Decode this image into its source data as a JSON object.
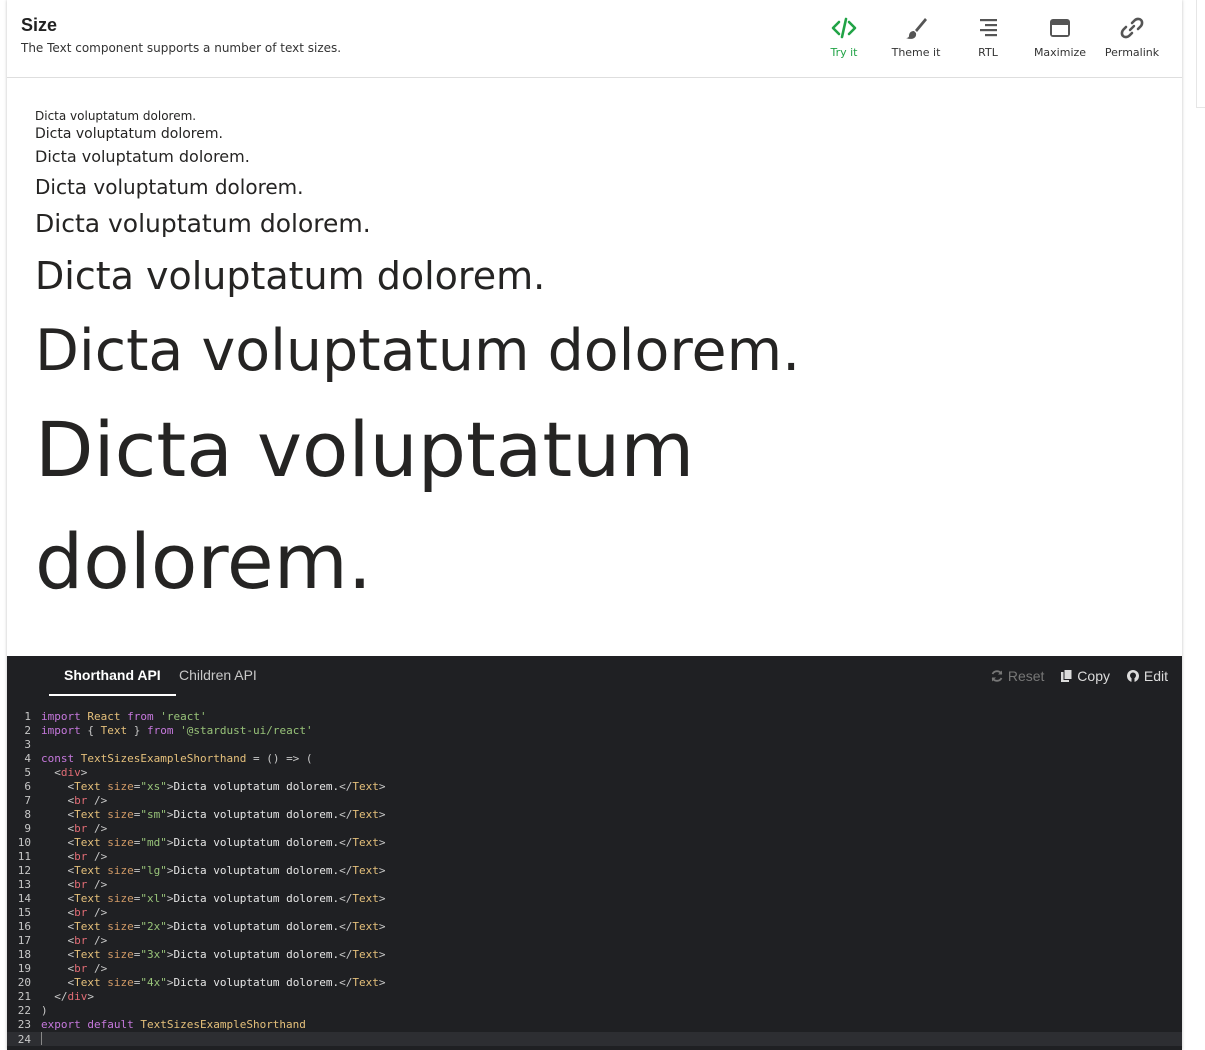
{
  "header": {
    "title": "Size",
    "description": "The Text component supports a number of text sizes."
  },
  "toolbar": [
    {
      "label": "Try it",
      "icon": "code-icon",
      "active": true
    },
    {
      "label": "Theme it",
      "icon": "paintbrush-icon",
      "active": false
    },
    {
      "label": "RTL",
      "icon": "align-right-icon",
      "active": false
    },
    {
      "label": "Maximize",
      "icon": "maximize-icon",
      "active": false
    },
    {
      "label": "Permalink",
      "icon": "link-icon",
      "active": false
    }
  ],
  "preview": {
    "samples": [
      {
        "size": "xs",
        "text": "Dicta voluptatum dolorem."
      },
      {
        "size": "sm",
        "text": "Dicta voluptatum dolorem."
      },
      {
        "size": "md",
        "text": "Dicta voluptatum dolorem."
      },
      {
        "size": "lg",
        "text": "Dicta voluptatum dolorem."
      },
      {
        "size": "xl",
        "text": "Dicta voluptatum dolorem."
      },
      {
        "size": "2x",
        "text": "Dicta voluptatum dolorem."
      },
      {
        "size": "3x",
        "text": "Dicta voluptatum dolorem."
      },
      {
        "size": "4x",
        "text": "Dicta voluptatum dolorem."
      }
    ]
  },
  "code_panel": {
    "tabs": [
      {
        "label": "Shorthand API",
        "active": true
      },
      {
        "label": "Children API",
        "active": false
      }
    ],
    "actions": {
      "reset": "Reset",
      "copy": "Copy",
      "edit": "Edit"
    },
    "lines": [
      [
        [
          "kw",
          "import"
        ],
        [
          "tk",
          " "
        ],
        [
          "id",
          "React"
        ],
        [
          "tk",
          " "
        ],
        [
          "kw",
          "from"
        ],
        [
          "tk",
          " "
        ],
        [
          "str",
          "'react'"
        ]
      ],
      [
        [
          "kw",
          "import"
        ],
        [
          "tk",
          " { "
        ],
        [
          "id",
          "Text"
        ],
        [
          "tk",
          " } "
        ],
        [
          "kw",
          "from"
        ],
        [
          "tk",
          " "
        ],
        [
          "str",
          "'@stardust-ui/react'"
        ]
      ],
      [],
      [
        [
          "kw",
          "const"
        ],
        [
          "tk",
          " "
        ],
        [
          "id",
          "TextSizesExampleShorthand"
        ],
        [
          "tk",
          " = () => ("
        ]
      ],
      [
        [
          "tk",
          "  <"
        ],
        [
          "tag",
          "div"
        ],
        [
          "tk",
          ">"
        ]
      ],
      [
        [
          "tk",
          "    <"
        ],
        [
          "id",
          "Text"
        ],
        [
          "tk",
          " "
        ],
        [
          "attr",
          "size"
        ],
        [
          "tk",
          "="
        ],
        [
          "str",
          "\"xs\""
        ],
        [
          "tk",
          ">"
        ],
        [
          "txt",
          "Dicta voluptatum dolorem."
        ],
        [
          "tk",
          "</"
        ],
        [
          "id",
          "Text"
        ],
        [
          "tk",
          ">"
        ]
      ],
      [
        [
          "tk",
          "    <"
        ],
        [
          "tag",
          "br"
        ],
        [
          "tk",
          " />"
        ]
      ],
      [
        [
          "tk",
          "    <"
        ],
        [
          "id",
          "Text"
        ],
        [
          "tk",
          " "
        ],
        [
          "attr",
          "size"
        ],
        [
          "tk",
          "="
        ],
        [
          "str",
          "\"sm\""
        ],
        [
          "tk",
          ">"
        ],
        [
          "txt",
          "Dicta voluptatum dolorem."
        ],
        [
          "tk",
          "</"
        ],
        [
          "id",
          "Text"
        ],
        [
          "tk",
          ">"
        ]
      ],
      [
        [
          "tk",
          "    <"
        ],
        [
          "tag",
          "br"
        ],
        [
          "tk",
          " />"
        ]
      ],
      [
        [
          "tk",
          "    <"
        ],
        [
          "id",
          "Text"
        ],
        [
          "tk",
          " "
        ],
        [
          "attr",
          "size"
        ],
        [
          "tk",
          "="
        ],
        [
          "str",
          "\"md\""
        ],
        [
          "tk",
          ">"
        ],
        [
          "txt",
          "Dicta voluptatum dolorem."
        ],
        [
          "tk",
          "</"
        ],
        [
          "id",
          "Text"
        ],
        [
          "tk",
          ">"
        ]
      ],
      [
        [
          "tk",
          "    <"
        ],
        [
          "tag",
          "br"
        ],
        [
          "tk",
          " />"
        ]
      ],
      [
        [
          "tk",
          "    <"
        ],
        [
          "id",
          "Text"
        ],
        [
          "tk",
          " "
        ],
        [
          "attr",
          "size"
        ],
        [
          "tk",
          "="
        ],
        [
          "str",
          "\"lg\""
        ],
        [
          "tk",
          ">"
        ],
        [
          "txt",
          "Dicta voluptatum dolorem."
        ],
        [
          "tk",
          "</"
        ],
        [
          "id",
          "Text"
        ],
        [
          "tk",
          ">"
        ]
      ],
      [
        [
          "tk",
          "    <"
        ],
        [
          "tag",
          "br"
        ],
        [
          "tk",
          " />"
        ]
      ],
      [
        [
          "tk",
          "    <"
        ],
        [
          "id",
          "Text"
        ],
        [
          "tk",
          " "
        ],
        [
          "attr",
          "size"
        ],
        [
          "tk",
          "="
        ],
        [
          "str",
          "\"xl\""
        ],
        [
          "tk",
          ">"
        ],
        [
          "txt",
          "Dicta voluptatum dolorem."
        ],
        [
          "tk",
          "</"
        ],
        [
          "id",
          "Text"
        ],
        [
          "tk",
          ">"
        ]
      ],
      [
        [
          "tk",
          "    <"
        ],
        [
          "tag",
          "br"
        ],
        [
          "tk",
          " />"
        ]
      ],
      [
        [
          "tk",
          "    <"
        ],
        [
          "id",
          "Text"
        ],
        [
          "tk",
          " "
        ],
        [
          "attr",
          "size"
        ],
        [
          "tk",
          "="
        ],
        [
          "str",
          "\"2x\""
        ],
        [
          "tk",
          ">"
        ],
        [
          "txt",
          "Dicta voluptatum dolorem."
        ],
        [
          "tk",
          "</"
        ],
        [
          "id",
          "Text"
        ],
        [
          "tk",
          ">"
        ]
      ],
      [
        [
          "tk",
          "    <"
        ],
        [
          "tag",
          "br"
        ],
        [
          "tk",
          " />"
        ]
      ],
      [
        [
          "tk",
          "    <"
        ],
        [
          "id",
          "Text"
        ],
        [
          "tk",
          " "
        ],
        [
          "attr",
          "size"
        ],
        [
          "tk",
          "="
        ],
        [
          "str",
          "\"3x\""
        ],
        [
          "tk",
          ">"
        ],
        [
          "txt",
          "Dicta voluptatum dolorem."
        ],
        [
          "tk",
          "</"
        ],
        [
          "id",
          "Text"
        ],
        [
          "tk",
          ">"
        ]
      ],
      [
        [
          "tk",
          "    <"
        ],
        [
          "tag",
          "br"
        ],
        [
          "tk",
          " />"
        ]
      ],
      [
        [
          "tk",
          "    <"
        ],
        [
          "id",
          "Text"
        ],
        [
          "tk",
          " "
        ],
        [
          "attr",
          "size"
        ],
        [
          "tk",
          "="
        ],
        [
          "str",
          "\"4x\""
        ],
        [
          "tk",
          ">"
        ],
        [
          "txt",
          "Dicta voluptatum dolorem."
        ],
        [
          "tk",
          "</"
        ],
        [
          "id",
          "Text"
        ],
        [
          "tk",
          ">"
        ]
      ],
      [
        [
          "tk",
          "  </"
        ],
        [
          "tag",
          "div"
        ],
        [
          "tk",
          ">"
        ]
      ],
      [
        [
          "tk",
          ")"
        ]
      ],
      [
        [
          "kw",
          "export"
        ],
        [
          "tk",
          " "
        ],
        [
          "kw",
          "default"
        ],
        [
          "tk",
          " "
        ],
        [
          "id",
          "TextSizesExampleShorthand"
        ]
      ],
      []
    ]
  },
  "colors": {
    "accent_active": "#21a346",
    "code_background": "#1f2023"
  }
}
